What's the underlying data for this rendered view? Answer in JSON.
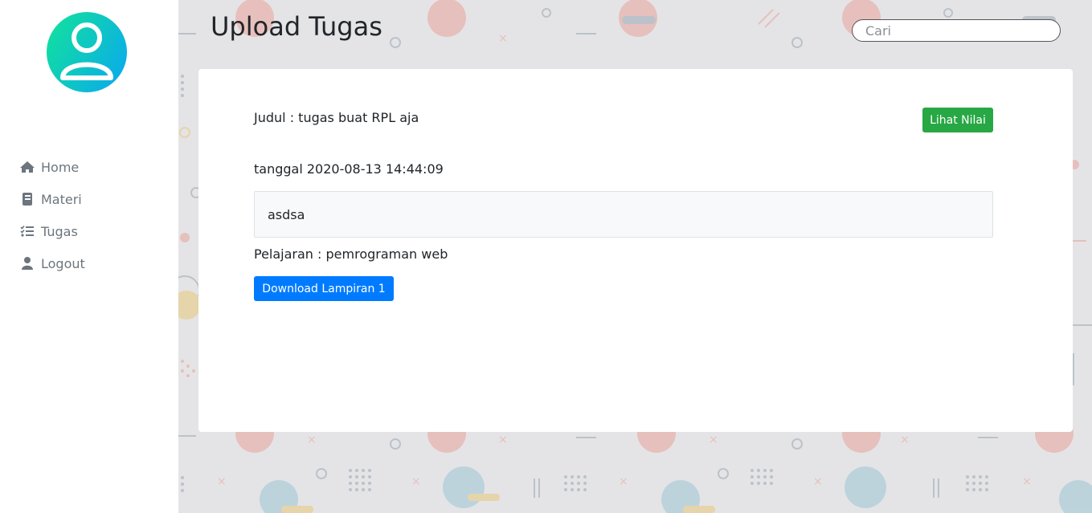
{
  "header": {
    "title": "Upload Tugas"
  },
  "search": {
    "placeholder": "Cari",
    "value": ""
  },
  "sidebar": {
    "items": [
      {
        "label": "Home",
        "icon": "home-icon"
      },
      {
        "label": "Materi",
        "icon": "book-icon"
      },
      {
        "label": "Tugas",
        "icon": "tasks-icon"
      },
      {
        "label": "Logout",
        "icon": "user-icon"
      }
    ]
  },
  "task": {
    "judul": "Judul : tugas buat RPL aja",
    "lihat_nilai_label": "Lihat Nilai",
    "tanggal": "tanggal 2020-08-13 14:44:09",
    "description": "asdsa",
    "pelajaran": "Pelajaran : pemrograman web",
    "download_label": "Download Lampiran 1"
  },
  "colors": {
    "success": "#28a745",
    "primary": "#007bff",
    "nav_text": "#6c757d",
    "avatar_gradient_start": "#12e39a",
    "avatar_gradient_end": "#0aa6f2"
  }
}
